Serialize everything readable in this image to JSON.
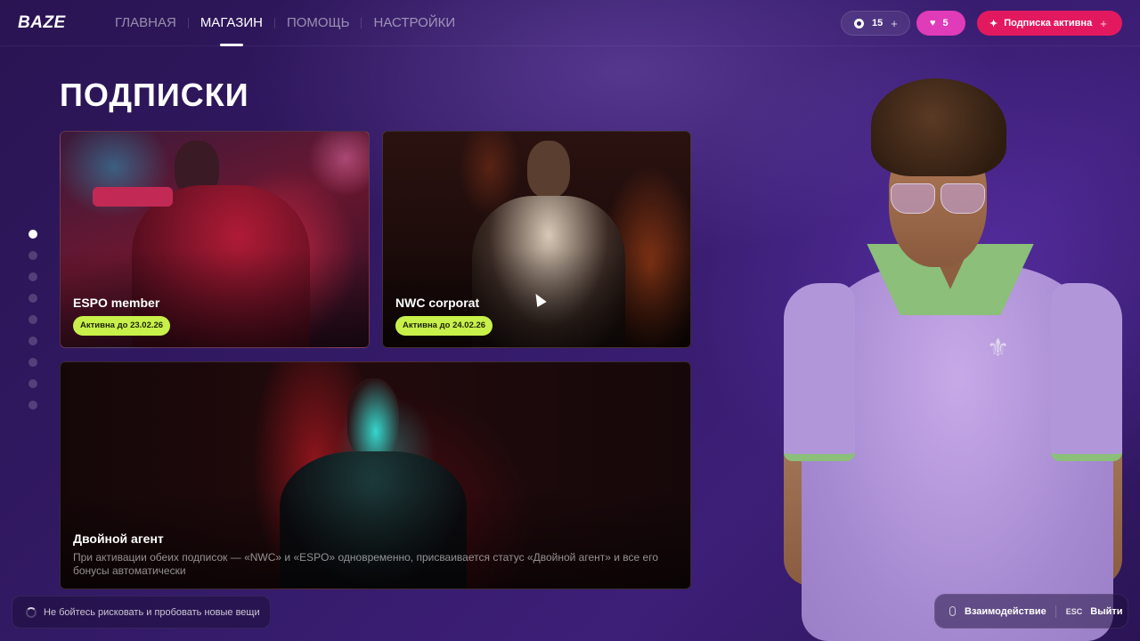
{
  "header": {
    "logo": "BAZE",
    "nav": [
      {
        "label": "ГЛАВНАЯ",
        "active": false
      },
      {
        "label": "МАГАЗИН",
        "active": true
      },
      {
        "label": "ПОМОЩЬ",
        "active": false
      },
      {
        "label": "НАСТРОЙКИ",
        "active": false
      }
    ],
    "coins": {
      "value": "15",
      "icon": "coin-icon",
      "action": "+"
    },
    "likes": {
      "value": "5",
      "icon": "heart-icon"
    },
    "subscription": {
      "label": "Подписка активна",
      "icon": "subscription-icon",
      "action": "+"
    }
  },
  "page": {
    "title": "ПОДПИСКИ",
    "pagination": {
      "count": 9,
      "active_index": 0
    }
  },
  "cards": [
    {
      "title": "ESPO member",
      "badge": "Активна до 23.02.26"
    },
    {
      "title": "NWC corporat",
      "badge": "Активна до 24.02.26"
    },
    {
      "title": "Двойной агент",
      "description": "При активации обеих подписок — «NWC» и «ESPO» одновременно, присваивается статус «Двойной агент» и все его бонусы автоматически"
    }
  ],
  "hint": {
    "text": "Не бойтесь рисковать и пробовать новые вещи"
  },
  "actions": {
    "interact_label": "Взаимодействие",
    "exit_key": "ESC",
    "exit_label": "Выйти"
  },
  "colors": {
    "accent_badge": "#c8f04a",
    "likes_pill": "#e03bb8",
    "subscription_pill": "#e3195f",
    "background": "#331a66"
  }
}
